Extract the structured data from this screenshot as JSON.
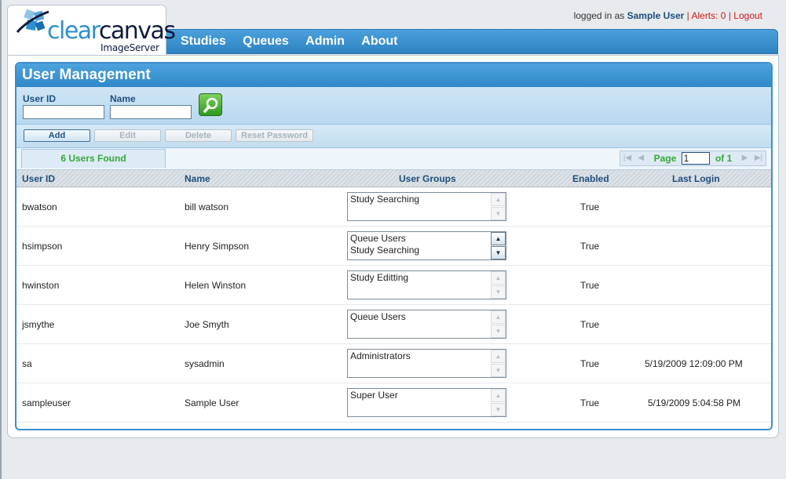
{
  "header": {
    "logo": {
      "clear": "clear",
      "canvas": "canvas",
      "sub": "ImageServer"
    },
    "user_info": {
      "prefix": "logged in as",
      "username": "Sample User",
      "separator": "|",
      "alerts": "Alerts: 0",
      "logout": "Logout"
    },
    "nav": [
      "Studies",
      "Queues",
      "Admin",
      "About"
    ]
  },
  "panel": {
    "title": "User Management",
    "filters": {
      "user_id_label": "User ID",
      "name_label": "Name",
      "user_id_value": "",
      "name_value": ""
    },
    "toolbar": {
      "add": "Add",
      "edit": "Edit",
      "delete": "Delete",
      "reset_password": "Reset Password"
    },
    "result_count": "6 Users Found",
    "pager": {
      "page_label": "Page",
      "page_value": "1",
      "of_label": "of 1"
    },
    "columns": {
      "user_id": "User ID",
      "name": "Name",
      "user_groups": "User Groups",
      "enabled": "Enabled",
      "last_login": "Last Login"
    },
    "rows": [
      {
        "user_id": "bwatson",
        "name": "bill watson",
        "groups": [
          "Study Searching"
        ],
        "enabled": "True",
        "last_login": ""
      },
      {
        "user_id": "hsimpson",
        "name": "Henry Simpson",
        "groups": [
          "Queue Users",
          "Study Searching"
        ],
        "enabled": "True",
        "last_login": ""
      },
      {
        "user_id": "hwinston",
        "name": "Helen Winston",
        "groups": [
          "Study Editting"
        ],
        "enabled": "True",
        "last_login": ""
      },
      {
        "user_id": "jsmythe",
        "name": "Joe Smyth",
        "groups": [
          "Queue Users"
        ],
        "enabled": "True",
        "last_login": ""
      },
      {
        "user_id": "sa",
        "name": "sysadmin",
        "groups": [
          "Administrators"
        ],
        "enabled": "True",
        "last_login": "5/19/2009 12:09:00 PM"
      },
      {
        "user_id": "sampleuser",
        "name": "Sample User",
        "groups": [
          "Super User"
        ],
        "enabled": "True",
        "last_login": "5/19/2009 5:04:58 PM"
      }
    ]
  },
  "colors": {
    "accent_blue": "#3088c8",
    "found_green": "#34a937",
    "alert_red": "#d01818"
  }
}
